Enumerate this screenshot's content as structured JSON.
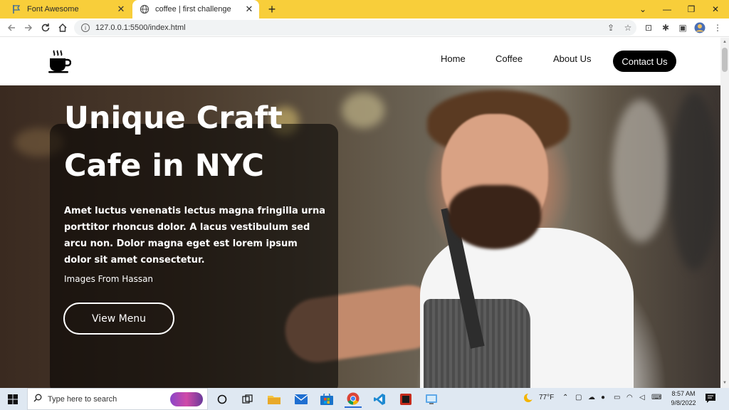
{
  "browser": {
    "tabs": [
      {
        "title": "Font Awesome",
        "active": false
      },
      {
        "title": "coffee | first challenge",
        "active": true
      }
    ],
    "new_tab": "+",
    "url": "127.0.0.1:5500/index.html"
  },
  "site": {
    "nav": {
      "links": [
        "Home",
        "Coffee",
        "About Us"
      ],
      "contact": "Contact Us"
    },
    "hero": {
      "headline_line1": "Unique Craft",
      "headline_line2": "Cafe in NYC",
      "description": "Amet luctus venenatis lectus magna fringilla urna porttitor rhoncus dolor. A lacus vestibulum sed arcu non. Dolor magna eget est lorem ipsum dolor sit amet consectetur.",
      "credit": "Images From Hassan",
      "button": "View Menu"
    }
  },
  "taskbar": {
    "search_placeholder": "Type here to search",
    "weather": "77°F",
    "time": "8:57 AM",
    "date": "9/8/2022"
  },
  "colors": {
    "tab_strip": "#f8ce3a",
    "taskbar": "#dfe8f2",
    "contact_bg": "#000000"
  }
}
